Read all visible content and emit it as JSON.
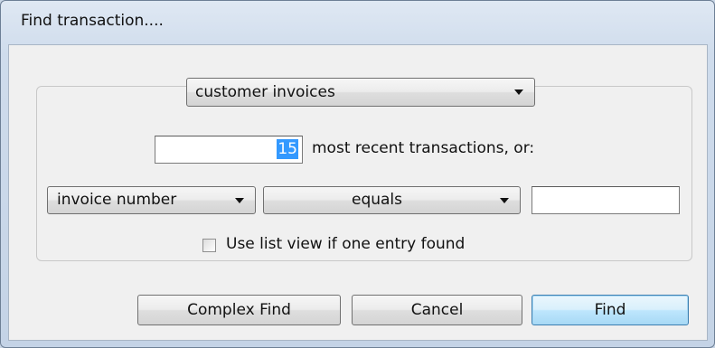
{
  "window": {
    "title": "Find transaction...."
  },
  "search_type": {
    "selected": "customer invoices"
  },
  "recent": {
    "count": "15",
    "label": "most recent transactions, or:"
  },
  "criteria": {
    "field": "invoice number",
    "operator": "equals",
    "value": ""
  },
  "options": {
    "list_view_label": "Use list view if one entry found",
    "list_view_checked": false
  },
  "buttons": {
    "complex_find": "Complex Find",
    "cancel": "Cancel",
    "find": "Find"
  }
}
